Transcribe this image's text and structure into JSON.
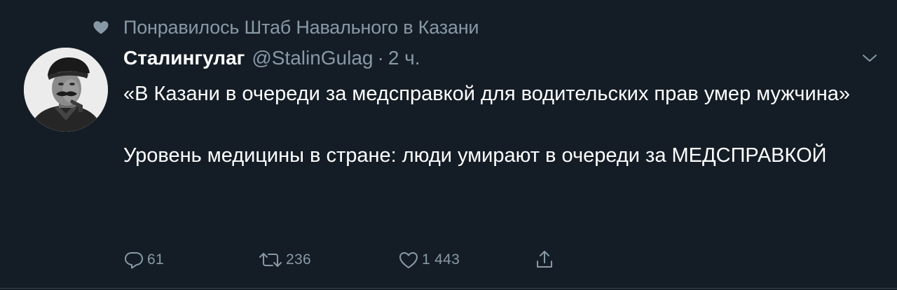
{
  "context": {
    "text": "Понравилось Штаб Навального в Казани",
    "icon": "heart-icon"
  },
  "author": {
    "display_name": "Сталингулаг",
    "handle": "@StalinGulag",
    "separator": "·",
    "time": "2 ч."
  },
  "tweet": {
    "line1": "«В Казани в очереди за медсправкой для водительских прав умер мужчина»",
    "line2": "Уровень медицины в стране: люди умирают в очереди за МЕДСПРАВКОЙ"
  },
  "actions": {
    "reply": {
      "icon": "reply-icon",
      "count": "61"
    },
    "retweet": {
      "icon": "retweet-icon",
      "count": "236"
    },
    "like": {
      "icon": "heart-outline-icon",
      "count": "1 443"
    },
    "share": {
      "icon": "share-icon"
    }
  },
  "colors": {
    "background": "#141d26",
    "text": "#ffffff",
    "muted": "#8899a6"
  }
}
